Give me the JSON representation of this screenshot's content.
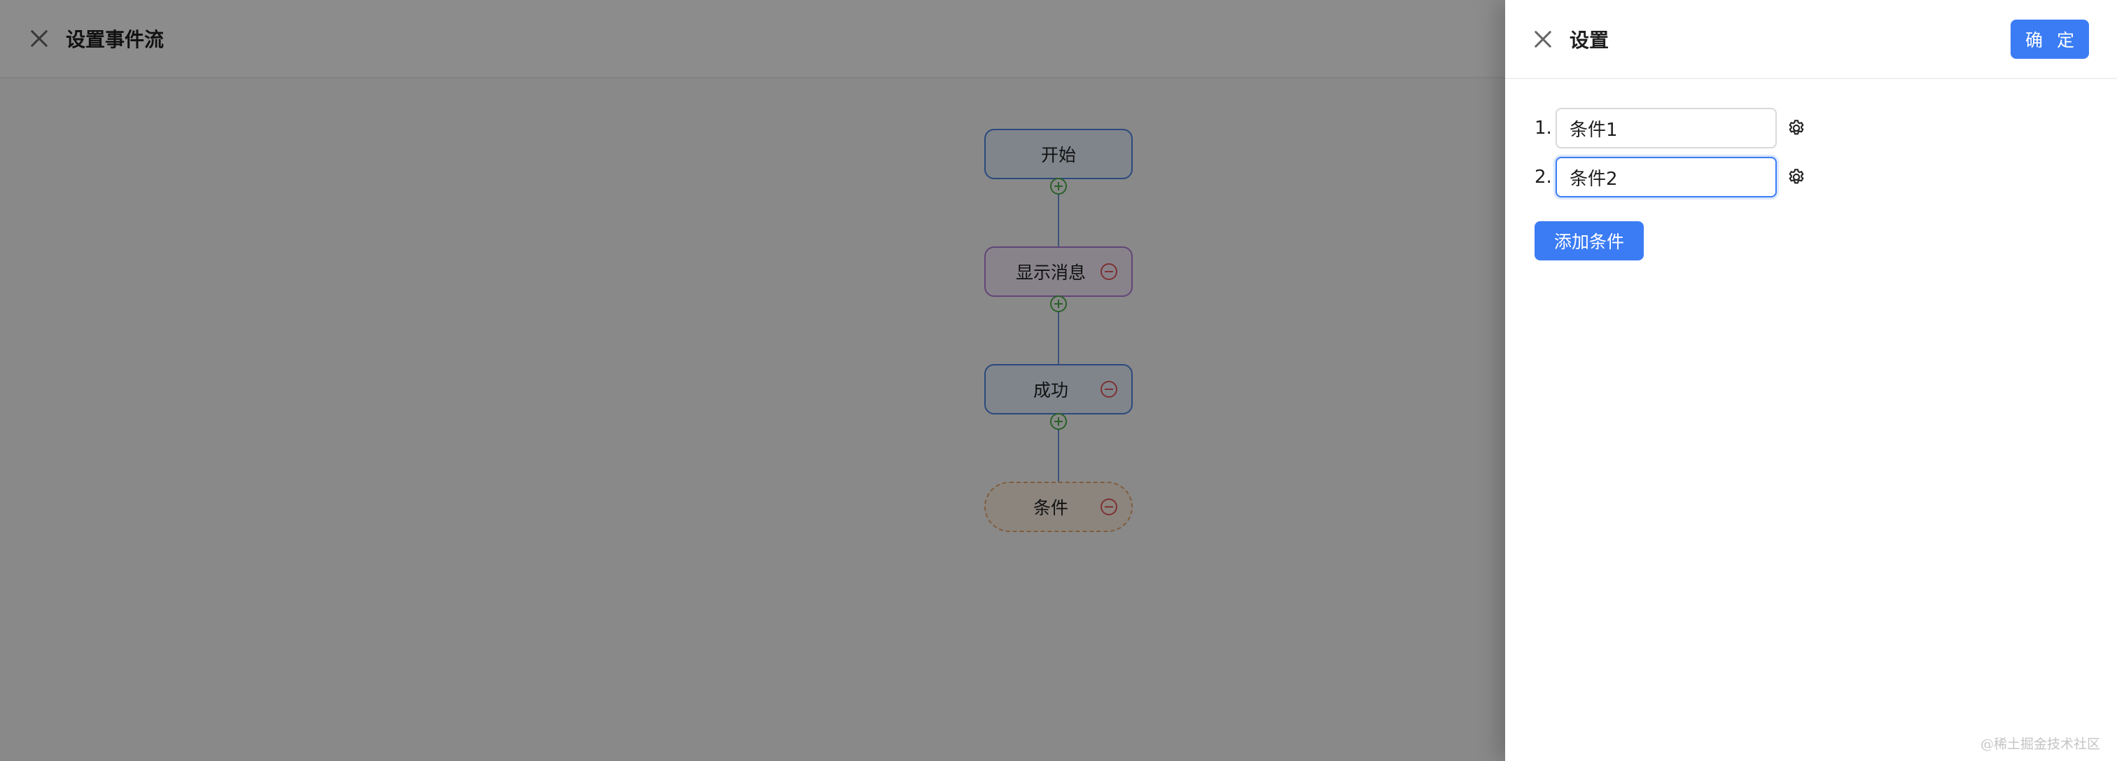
{
  "page": {
    "title": "设置事件流"
  },
  "flow": {
    "nodes": [
      {
        "label": "开始",
        "type": "start"
      },
      {
        "label": "显示消息",
        "type": "message"
      },
      {
        "label": "成功",
        "type": "action"
      },
      {
        "label": "条件",
        "type": "condition"
      }
    ]
  },
  "drawer": {
    "title": "设置",
    "confirm_label": "确 定",
    "conditions": [
      {
        "index": "1.",
        "value": "条件1"
      },
      {
        "index": "2.",
        "value": "条件2"
      }
    ],
    "add_label": "添加条件"
  },
  "watermark": "@稀土掘金技术社区",
  "colors": {
    "primary": "#3b7cf4",
    "node_blue": "#4f86e4",
    "node_purple": "#b27ed8",
    "node_orange": "#e7a974",
    "add_green": "#4cb04c",
    "remove_red": "#e35a5a"
  },
  "icons": {
    "close": "close-icon",
    "add": "plus-circle-icon",
    "remove": "minus-circle-icon",
    "settings": "gear-icon"
  }
}
